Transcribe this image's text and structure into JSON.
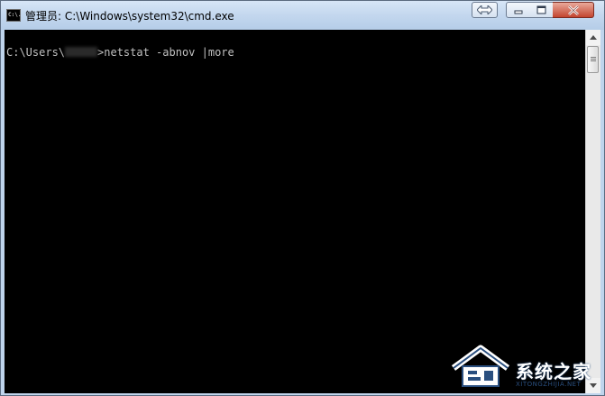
{
  "window": {
    "title": "管理员: C:\\Windows\\system32\\cmd.exe",
    "app_icon_text": "C:\\."
  },
  "console": {
    "prompt_prefix": "C:\\Users\\",
    "prompt_suffix": ">netstat -abnov |more"
  },
  "watermark": {
    "text_cn": "系统之家",
    "text_en": "XITONGZHIJIA.NET"
  },
  "colors": {
    "console_bg": "#000000",
    "console_fg": "#c0c0c0",
    "titlebar": "#c3d7ee",
    "close_button": "#c3452f"
  }
}
